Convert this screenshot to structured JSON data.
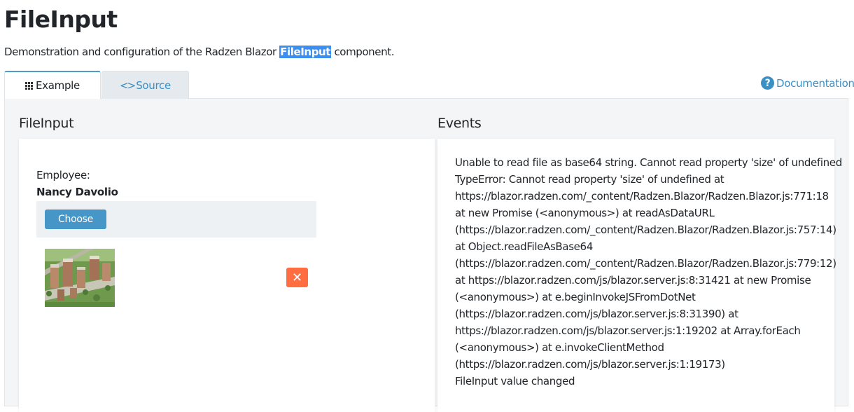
{
  "page": {
    "title": "FileInput",
    "subtitle_before": "Demonstration and configuration of the Radzen Blazor ",
    "subtitle_highlight": "FileInput",
    "subtitle_after": " component."
  },
  "tabs": [
    {
      "label": "Example",
      "icon": "grid-icon",
      "active": true
    },
    {
      "label": "Source",
      "icon": "code-icon",
      "active": false
    }
  ],
  "documentation": {
    "label": "Documentation",
    "icon": "help-icon"
  },
  "sections": {
    "left_title": "FileInput",
    "right_title": "Events"
  },
  "form": {
    "employee_label": "Employee:",
    "employee_name": "Nancy Davolio",
    "choose_label": "Choose",
    "remove_icon": "✕"
  },
  "events": {
    "lines": [
      "Unable to read file as base64 string. Cannot read property 'size' of undefined",
      "TypeError: Cannot read property 'size' of undefined at",
      "https://blazor.radzen.com/_content/Radzen.Blazor/Radzen.Blazor.js:771:18",
      "at new Promise (<anonymous>) at readAsDataURL",
      "(https://blazor.radzen.com/_content/Radzen.Blazor/Radzen.Blazor.js:757:14)",
      "at Object.readFileAsBase64",
      "(https://blazor.radzen.com/_content/Radzen.Blazor/Radzen.Blazor.js:779:12)",
      "at https://blazor.radzen.com/js/blazor.server.js:8:31421 at new Promise",
      "(<anonymous>) at e.beginInvokeJSFromDotNet",
      "(https://blazor.radzen.com/js/blazor.server.js:8:31390) at",
      "https://blazor.radzen.com/js/blazor.server.js:1:19202 at Array.forEach",
      "(<anonymous>) at e.invokeClientMethod",
      "(https://blazor.radzen.com/js/blazor.server.js:1:19173)",
      "FileInput value changed"
    ]
  },
  "colors": {
    "accent": "#3a8fc5",
    "button": "#4796c8",
    "remove": "#ff6d41",
    "highlight": "#3b8ff0"
  }
}
